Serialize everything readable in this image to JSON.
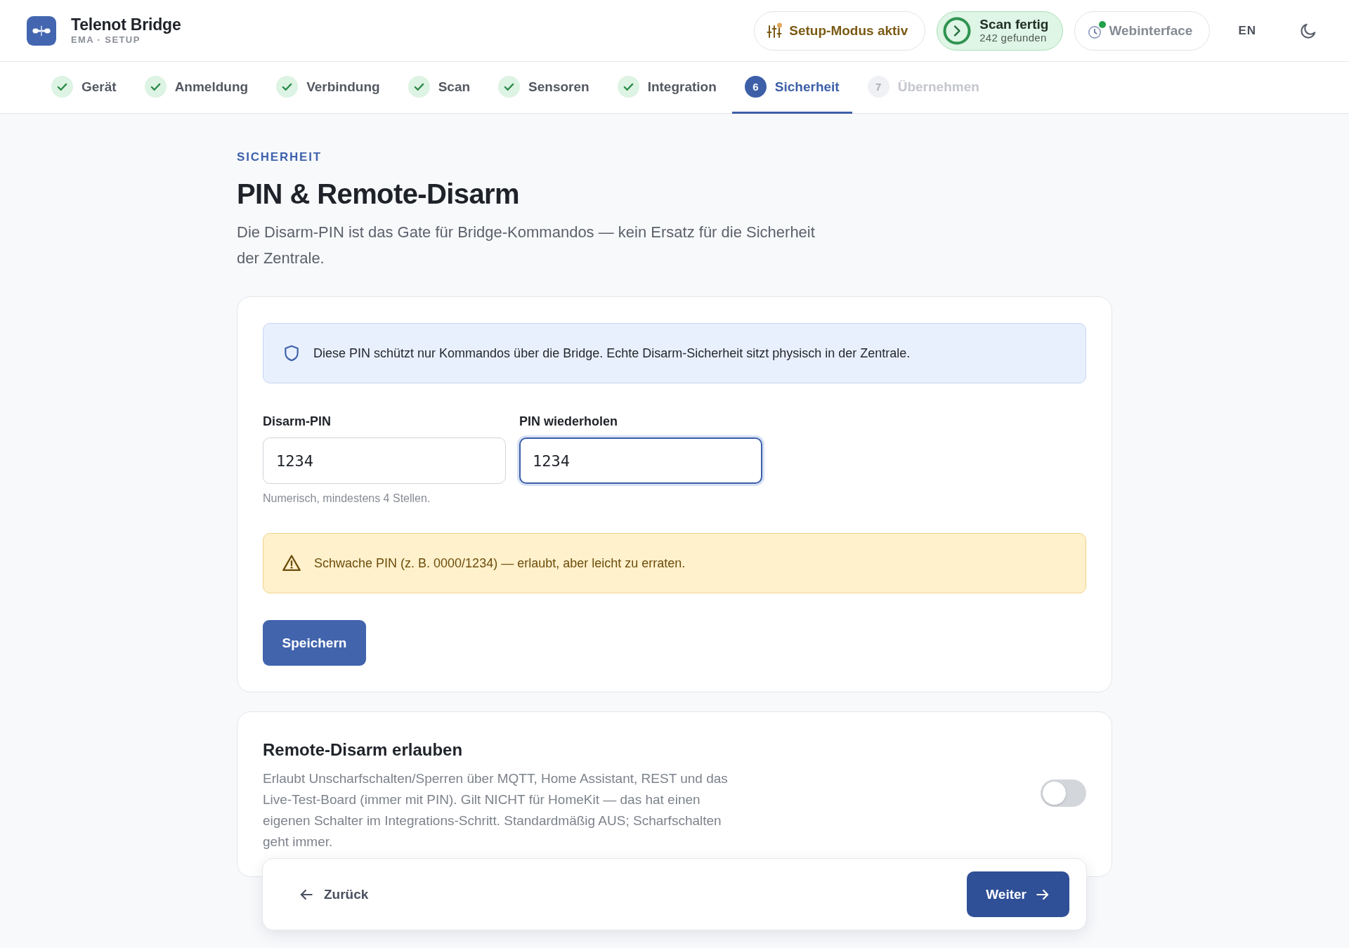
{
  "header": {
    "app_title": "Telenot Bridge",
    "app_subtitle": "EMA · SETUP",
    "setup_mode": {
      "label": "Setup-Modus aktiv"
    },
    "scan_status": {
      "title": "Scan fertig",
      "detail": "242 gefunden"
    },
    "webinterface": {
      "label": "Webinterface",
      "online": true
    },
    "language": "EN"
  },
  "steps": [
    {
      "label": "Gerät",
      "done": true,
      "selected": false
    },
    {
      "label": "Anmeldung",
      "done": true,
      "selected": false
    },
    {
      "label": "Verbindung",
      "done": true,
      "selected": false
    },
    {
      "label": "Scan",
      "done": true,
      "selected": false
    },
    {
      "label": "Sensoren",
      "done": true,
      "selected": false
    },
    {
      "label": "Integration",
      "done": true,
      "selected": false
    },
    {
      "number": "6",
      "label": "Sicherheit",
      "done": false,
      "selected": true
    },
    {
      "number": "7",
      "label": "Übernehmen",
      "done": false,
      "selected": false
    }
  ],
  "page": {
    "eyebrow": "SICHERHEIT",
    "title": "PIN & Remote-Disarm",
    "description": "Die Disarm-PIN ist das Gate für Bridge-Kommandos — kein Ersatz für die Sicherheit der Zentrale."
  },
  "pin_card": {
    "info": "Diese PIN schützt nur Kommandos über die Bridge. Echte Disarm-Sicherheit sitzt physisch in der Zentrale.",
    "fields": [
      {
        "label": "Disarm-PIN",
        "value": "1234",
        "focused": false,
        "hint": "Numerisch, mindestens 4 Stellen."
      },
      {
        "label": "PIN wiederholen",
        "value": "1234",
        "focused": true
      }
    ],
    "warning": "Schwache PIN (z. B. 0000/1234) — erlaubt, aber leicht zu erraten.",
    "save_button": "Speichern"
  },
  "remote_card": {
    "title": "Remote-Disarm erlauben",
    "description": "Erlaubt Unscharfschalten/Sperren über MQTT, Home Assistant, REST und das Live-Test-Board (immer mit PIN). Gilt NICHT für HomeKit — das hat einen eigenen Schalter im Integrations-Schritt. Standardmäßig AUS; Scharfschalten geht immer.",
    "on": false
  },
  "footer": {
    "back": "Zurück",
    "next": "Weiter"
  }
}
